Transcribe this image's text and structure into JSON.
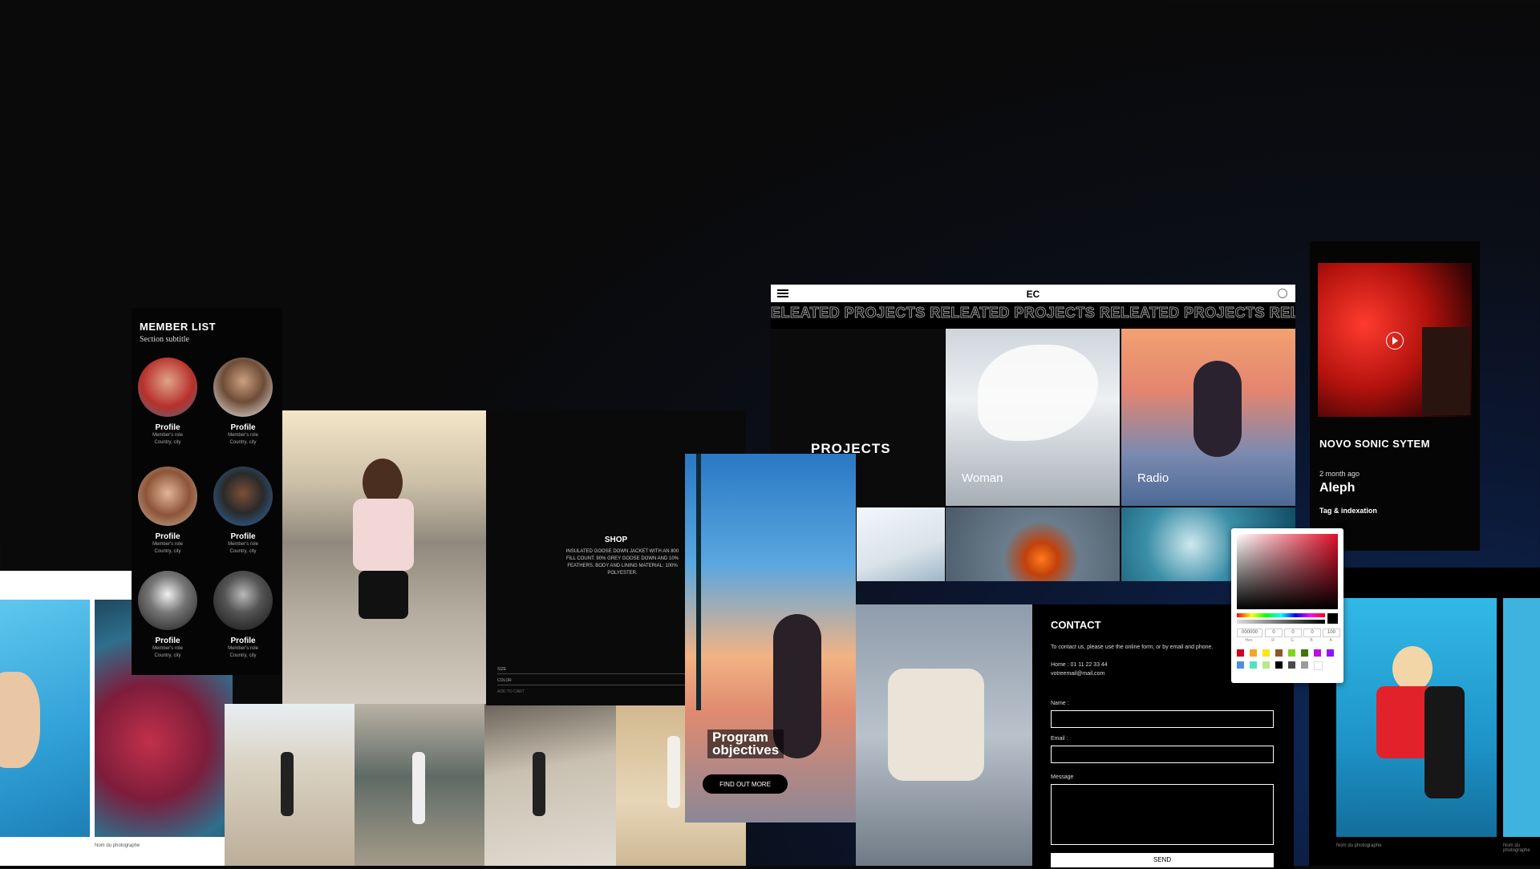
{
  "member_list": {
    "title": "MEMBER LIST",
    "subtitle": "Section subtitle",
    "members": [
      {
        "name": "Profile",
        "role": "Member's role",
        "place": "Country, city"
      },
      {
        "name": "Profile",
        "role": "Member's role",
        "place": "Country, city"
      },
      {
        "name": "Profile",
        "role": "Member's role",
        "place": "Country, city"
      },
      {
        "name": "Profile",
        "role": "Member's role",
        "place": "Country, city"
      },
      {
        "name": "Profile",
        "role": "Member's role",
        "place": "Country, city"
      },
      {
        "name": "Profile",
        "role": "Member's role",
        "place": "Country, city"
      }
    ]
  },
  "shop": {
    "title": "SHOP",
    "description": "INSULATED GOOSE DOWN JACKET WITH AN 800 FILL COUNT. 90% GREY GOOSE DOWN AND 10% FEATHERS. BODY AND LINING MATERIAL: 100% POLYESTER.",
    "size_label": "SIZE",
    "color_label": "COLOR",
    "add_to_cart": "ADD TO CART"
  },
  "projects_window": {
    "title": "EC",
    "marquee": "ELEATED PROJECTS RELEATED PROJECTS RELEATED PROJECTS RELEATED PROJEC",
    "heading": "PROJECTS",
    "tiles": [
      {
        "label": "Woman"
      },
      {
        "label": "Radio"
      }
    ]
  },
  "novo": {
    "title": "NOVO SONIC SYTEM",
    "time": "2 month ago",
    "name": "Aleph",
    "tag": "Tag & indexation"
  },
  "program": {
    "title_line1": "Program",
    "title_line2": "objectives",
    "cta": "FIND OUT MORE"
  },
  "contact": {
    "title": "CONTACT",
    "intro": "To contact us, please use the online form, or by email and phone.",
    "phone": "Home : 01 11 22 33 44",
    "email": "votreemail@mail.com",
    "name_label": "Name :",
    "email_label": "Email :",
    "message_label": "Message",
    "send": "SEND"
  },
  "color_picker": {
    "hex": "000000",
    "r": "0",
    "g": "0",
    "b": "0",
    "a": "100",
    "labels": [
      "Hex",
      "R",
      "G",
      "B",
      "A"
    ],
    "swatches": [
      "#d0021b",
      "#f5a623",
      "#f8e71c",
      "#8b572a",
      "#7ed321",
      "#417505",
      "#bd10e0",
      "#9013fe",
      "#4a90e2",
      "#50e3c2",
      "#b8e986",
      "#000000",
      "#4a4a4a",
      "#9b9b9b",
      "#ffffff"
    ]
  },
  "captions": {
    "left": "Nom du photographe",
    "right": "Nom du photographe",
    "far_right": "Nom du photographe"
  }
}
